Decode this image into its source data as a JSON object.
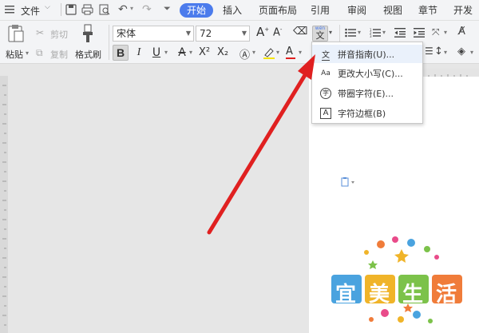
{
  "topbar": {
    "file_menu": "文件",
    "tabs": [
      {
        "label": "开始",
        "active": true
      },
      {
        "label": "插入"
      },
      {
        "label": "页面布局"
      },
      {
        "label": "引用"
      },
      {
        "label": "审阅"
      },
      {
        "label": "视图"
      },
      {
        "label": "章节"
      },
      {
        "label": "开发工"
      }
    ]
  },
  "ribbon": {
    "paste_label": "粘贴",
    "cut_label": "剪切",
    "copy_label": "复制",
    "format_painter_label": "格式刷",
    "font_name": "宋体",
    "font_size": "72",
    "superscript": "X²",
    "subscript": "X₂"
  },
  "pinyin_button": {
    "ruby": "wén",
    "char": "文"
  },
  "dropdown": {
    "items": [
      {
        "label": "拼音指南(U)...",
        "icon": "pinyin-icon",
        "glyph": "文"
      },
      {
        "label": "更改大小写(C)...",
        "icon": "change-case-icon",
        "glyph": "Aa"
      },
      {
        "label": "带圈字符(E)...",
        "icon": "enclosed-char-icon",
        "glyph": "字"
      },
      {
        "label": "字符边框(B)",
        "icon": "char-border-icon",
        "glyph": "A"
      }
    ]
  },
  "document": {
    "clipart": {
      "chars": [
        "宜",
        "美",
        "生",
        "活"
      ],
      "colors": [
        "#4aa3df",
        "#f0b429",
        "#7cc24a",
        "#f07c3a"
      ]
    }
  },
  "arrow_color": "#e02020",
  "accent": "#4b7bec"
}
